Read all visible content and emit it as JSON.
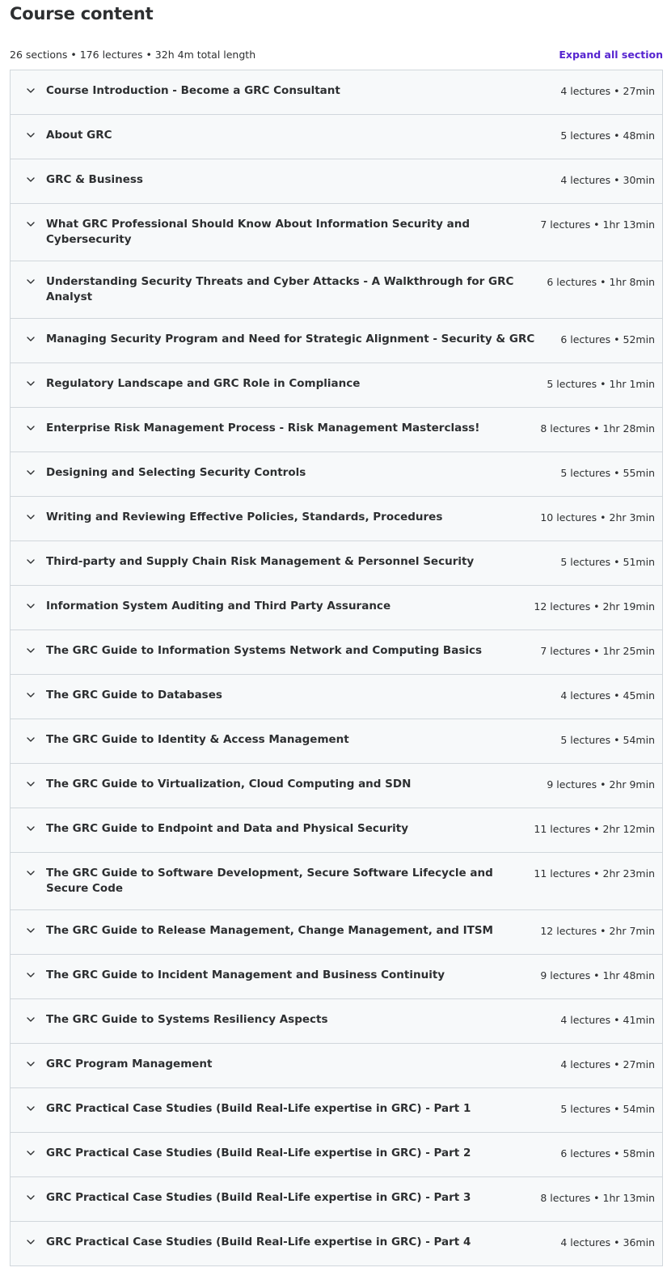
{
  "header": {
    "title": "Course content",
    "summary": "26 sections • 176 lectures • 32h 4m total length",
    "expand_all_label": "Expand all section"
  },
  "colors": {
    "accent": "#5624d0",
    "section_bg": "#f7f9fa",
    "border": "#d1d7dc",
    "text": "#2d2f31"
  },
  "icons": {
    "section_toggle": "chevron-down-icon"
  },
  "sections": [
    {
      "title": "Course Introduction - Become a GRC Consultant",
      "meta": "4 lectures • 27min"
    },
    {
      "title": "About GRC",
      "meta": "5 lectures • 48min"
    },
    {
      "title": "GRC & Business",
      "meta": "4 lectures • 30min"
    },
    {
      "title": "What GRC Professional Should Know About Information Security and Cybersecurity",
      "meta": "7 lectures • 1hr 13min"
    },
    {
      "title": "Understanding Security Threats and Cyber Attacks - A Walkthrough for GRC Analyst",
      "meta": "6 lectures • 1hr 8min"
    },
    {
      "title": "Managing Security Program and Need for Strategic Alignment - Security & GRC",
      "meta": "6 lectures • 52min"
    },
    {
      "title": "Regulatory Landscape and GRC Role in Compliance",
      "meta": "5 lectures • 1hr 1min"
    },
    {
      "title": "Enterprise Risk Management Process - Risk Management Masterclass!",
      "meta": "8 lectures • 1hr 28min"
    },
    {
      "title": "Designing and Selecting Security Controls",
      "meta": "5 lectures • 55min"
    },
    {
      "title": "Writing and Reviewing Effective Policies, Standards, Procedures",
      "meta": "10 lectures • 2hr 3min"
    },
    {
      "title": "Third-party and Supply Chain Risk Management & Personnel Security",
      "meta": "5 lectures • 51min"
    },
    {
      "title": "Information System Auditing and Third Party Assurance",
      "meta": "12 lectures • 2hr 19min"
    },
    {
      "title": "The GRC Guide to Information Systems Network and Computing Basics",
      "meta": "7 lectures • 1hr 25min"
    },
    {
      "title": "The GRC Guide to Databases",
      "meta": "4 lectures • 45min"
    },
    {
      "title": "The GRC Guide to Identity & Access Management",
      "meta": "5 lectures • 54min"
    },
    {
      "title": "The GRC Guide to Virtualization, Cloud Computing and SDN",
      "meta": "9 lectures • 2hr 9min"
    },
    {
      "title": "The GRC Guide to Endpoint and Data and Physical Security",
      "meta": "11 lectures • 2hr 12min"
    },
    {
      "title": "The GRC Guide to Software Development, Secure Software Lifecycle and Secure Code",
      "meta": "11 lectures • 2hr 23min"
    },
    {
      "title": "The GRC Guide to Release Management, Change Management, and ITSM",
      "meta": "12 lectures • 2hr 7min"
    },
    {
      "title": "The GRC Guide to Incident Management and Business Continuity",
      "meta": "9 lectures • 1hr 48min"
    },
    {
      "title": "The GRC Guide to Systems Resiliency Aspects",
      "meta": "4 lectures • 41min"
    },
    {
      "title": "GRC Program Management",
      "meta": "4 lectures • 27min"
    },
    {
      "title": "GRC Practical Case Studies (Build Real-Life expertise in GRC) - Part 1",
      "meta": "5 lectures • 54min"
    },
    {
      "title": "GRC Practical Case Studies (Build Real-Life expertise in GRC) - Part 2",
      "meta": "6 lectures • 58min"
    },
    {
      "title": "GRC Practical Case Studies (Build Real-Life expertise in GRC) - Part 3",
      "meta": "8 lectures • 1hr 13min"
    },
    {
      "title": "GRC Practical Case Studies (Build Real-Life expertise in GRC) - Part 4",
      "meta": "4 lectures • 36min"
    }
  ]
}
